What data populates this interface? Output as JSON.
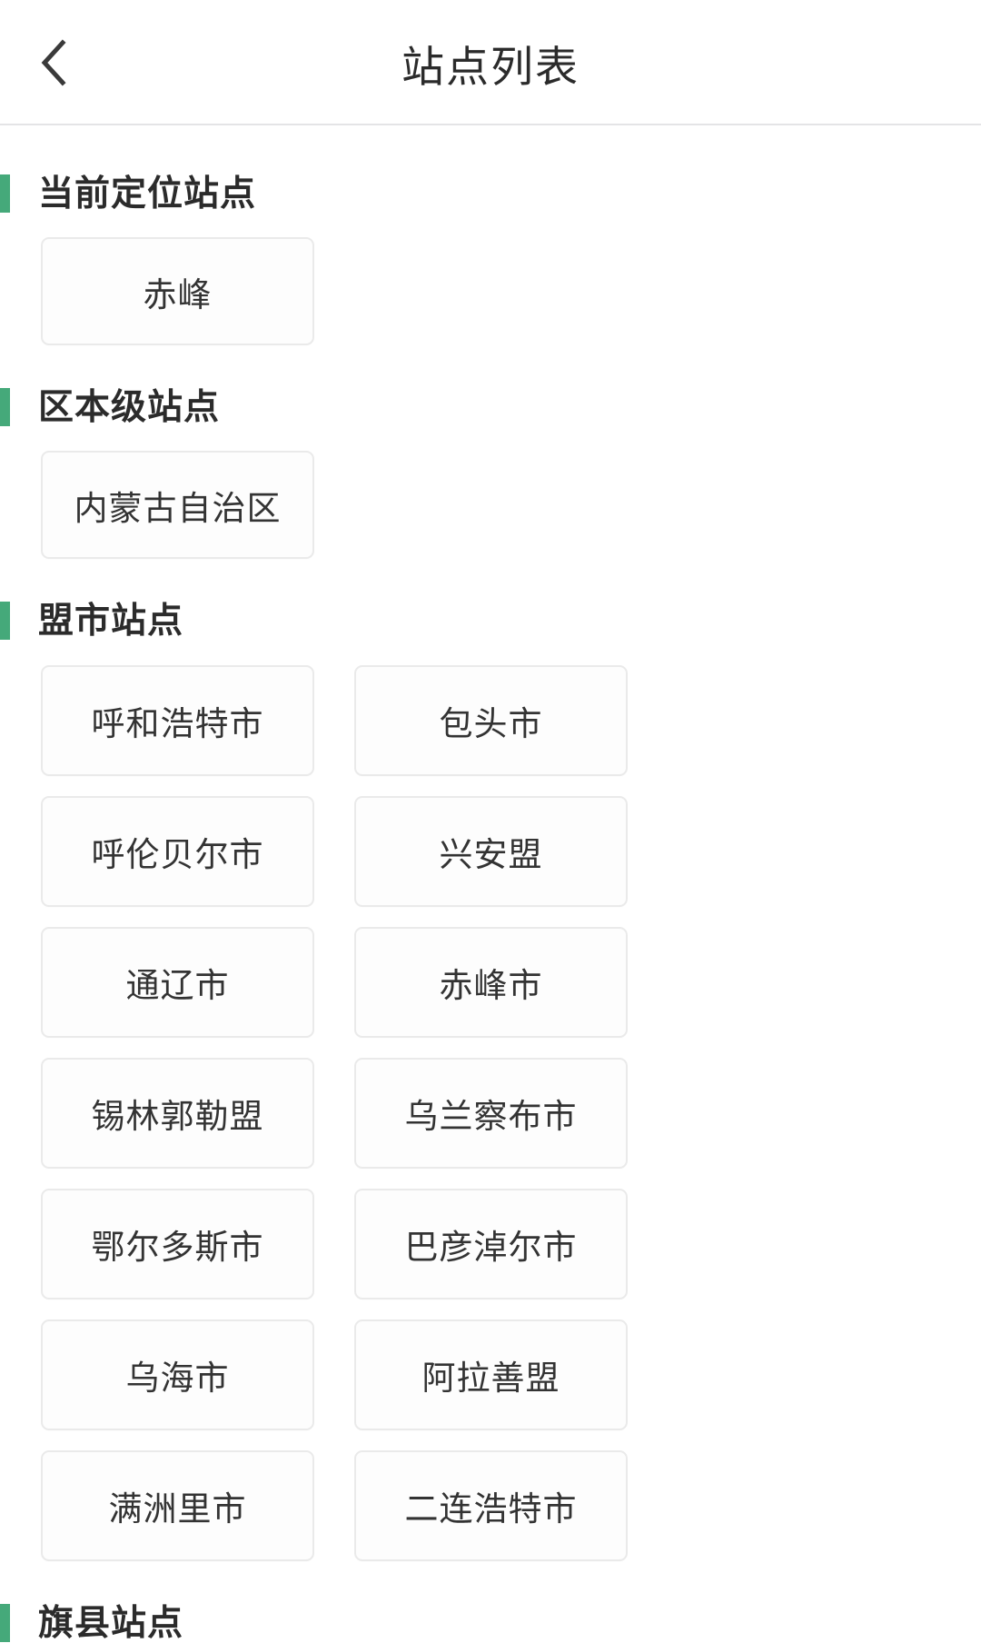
{
  "header": {
    "title": "站点列表",
    "back_icon": "chevron-left-icon"
  },
  "theme": {
    "accent": "#45a97a",
    "page_background": "#ffffff",
    "card_background": "#fdfdfd",
    "card_border": "#eaeaea",
    "title_color": "#2b2b2b",
    "card_text_color": "#333333",
    "divider": "#e4e4e6"
  },
  "sections": [
    {
      "title": "当前定位站点",
      "items": [
        "赤峰"
      ]
    },
    {
      "title": "区本级站点",
      "items": [
        "内蒙古自治区"
      ]
    },
    {
      "title": "盟市站点",
      "items": [
        "呼和浩特市",
        "包头市",
        "呼伦贝尔市",
        "兴安盟",
        "通辽市",
        "赤峰市",
        "锡林郭勒盟",
        "乌兰察布市",
        "鄂尔多斯市",
        "巴彦淖尔市",
        "乌海市",
        "阿拉善盟",
        "满洲里市",
        "二连浩特市"
      ]
    },
    {
      "title": "旗县站点",
      "items": []
    }
  ]
}
